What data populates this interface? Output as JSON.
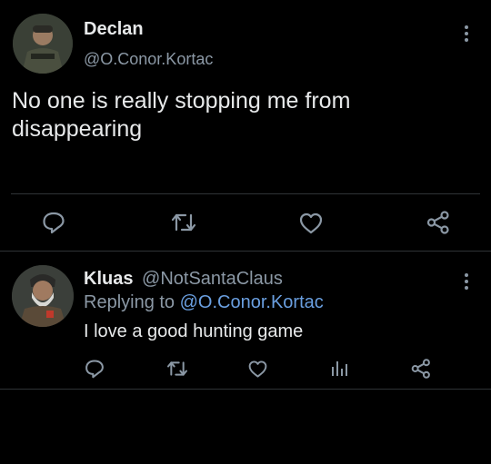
{
  "main_tweet": {
    "display_name": "Declan",
    "handle": "@O.Conor.Kortac",
    "text_line1": "No one is really stopping me from",
    "text_line2": "disappearing",
    "actions": [
      "reply-icon",
      "retweet-icon",
      "like-icon",
      "share-icon"
    ]
  },
  "reply_tweet": {
    "display_name": "Kluas",
    "handle": "@NotSantaClaus",
    "replying_prefix": "Replying to",
    "replying_handle": "@O.Conor.Kortac",
    "text": "I love a good hunting game",
    "actions": [
      "reply-icon",
      "retweet-icon",
      "like-icon",
      "analytics-icon",
      "share-icon"
    ]
  },
  "colors": {
    "background": "#000000",
    "text": "#e7e9ea",
    "muted": "#8b98a5",
    "link": "#6a9fe0",
    "divider": "#2f3336"
  }
}
